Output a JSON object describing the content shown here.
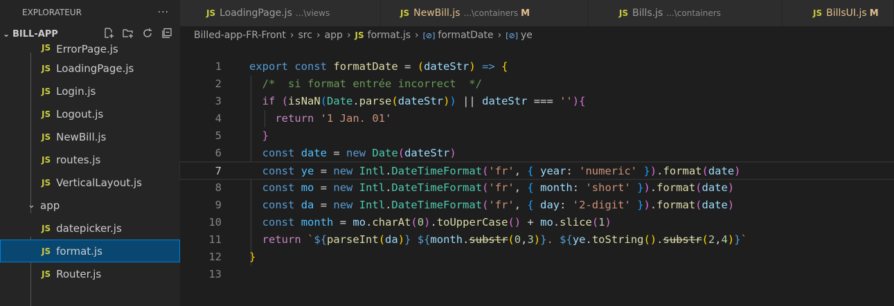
{
  "explorer": {
    "title": "EXPLORATEUR",
    "more": "···",
    "section": "BILL-APP",
    "items": [
      {
        "label": "ErrorPage.js"
      },
      {
        "label": "LoadingPage.js"
      },
      {
        "label": "Login.js"
      },
      {
        "label": "Logout.js"
      },
      {
        "label": "NewBill.js"
      },
      {
        "label": "routes.js"
      },
      {
        "label": "VerticalLayout.js"
      }
    ],
    "folder": "app",
    "app_items": [
      {
        "label": "datepicker.js"
      },
      {
        "label": "format.js"
      },
      {
        "label": "Router.js"
      }
    ],
    "js_badge": "JS"
  },
  "tabs": [
    {
      "name": "LoadingPage.js",
      "desc": "...\\views",
      "mod": ""
    },
    {
      "name": "NewBill.js",
      "desc": "...\\containers",
      "mod": "M"
    },
    {
      "name": "Bills.js",
      "desc": "...\\containers",
      "mod": ""
    },
    {
      "name": "BillsUI.js",
      "desc": "",
      "mod": "M"
    }
  ],
  "breadcrumb": {
    "parts": [
      "Billed-app-FR-Front",
      "src",
      "app"
    ],
    "file": "format.js",
    "symbol1": "formatDate",
    "symbol2": "ye"
  },
  "editor": {
    "current_line": 7,
    "line_numbers": [
      "1",
      "2",
      "3",
      "4",
      "5",
      "6",
      "7",
      "8",
      "9",
      "10",
      "11",
      "12",
      "13"
    ]
  }
}
